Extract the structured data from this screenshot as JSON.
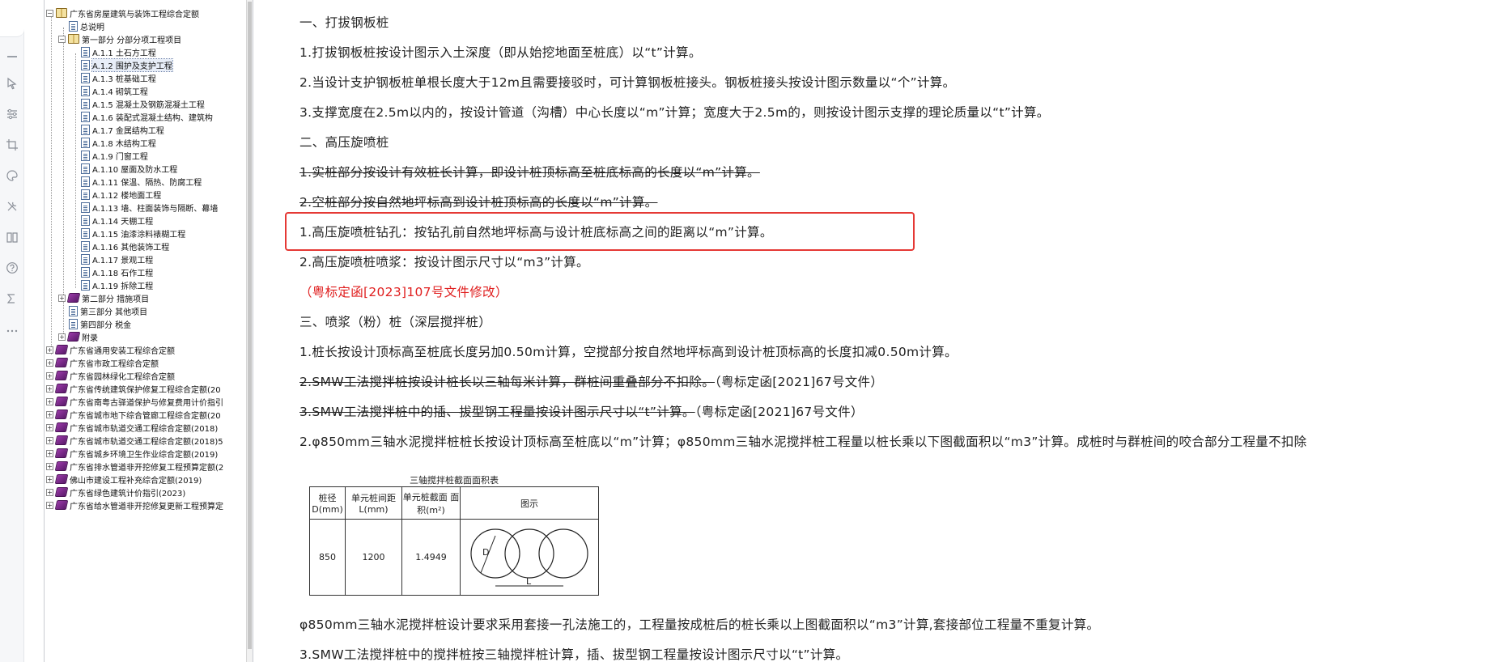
{
  "tree": {
    "root": "广东省房屋建筑与装饰工程综合定额",
    "general": "总说明",
    "part1": "第一部分 分部分项工程项目",
    "sections": [
      "A.1.1 土石方工程",
      "A.1.2 围护及支护工程",
      "A.1.3 桩基础工程",
      "A.1.4 砌筑工程",
      "A.1.5 混凝土及钢筋混凝土工程",
      "A.1.6 装配式混凝土结构、建筑构",
      "A.1.7 金属结构工程",
      "A.1.8 木结构工程",
      "A.1.9 门窗工程",
      "A.1.10 屋面及防水工程",
      "A.1.11 保温、隔热、防腐工程",
      "A.1.12 楼地面工程",
      "A.1.13 墙、柱面装饰与隔断、幕墙",
      "A.1.14 天棚工程",
      "A.1.15 油漆涂料裱糊工程",
      "A.1.16 其他装饰工程",
      "A.1.17 景观工程",
      "A.1.18 石作工程",
      "A.1.19 拆除工程"
    ],
    "part2": "第二部分 措施项目",
    "part3": "第三部分 其他项目",
    "part4": "第四部分 税金",
    "appendix": "附录",
    "others": [
      "广东省通用安装工程综合定额",
      "广东省市政工程综合定额",
      "广东省园林绿化工程综合定额",
      "广东省传统建筑保护修复工程综合定额(20",
      "广东省南粤古驿道保护与修复费用计价指引",
      "广东省城市地下综合管廊工程综合定额(20",
      "广东省城市轨道交通工程综合定额(2018)",
      "广东省城市轨道交通工程综合定额(2018)5",
      "广东省城乡环境卫生作业综合定额(2019)",
      "广东省排水管道非开挖修复工程预算定额(2",
      "佛山市建设工程补充综合定额(2019)",
      "广东省绿色建筑计价指引(2023)",
      "广东省给水管道非开挖修复更新工程预算定"
    ]
  },
  "content": {
    "h1": "一、打拔钢板桩",
    "s1_1": "1.打拔钢板桩按设计图示入土深度（即从始挖地面至桩底）以“t”计算。",
    "s1_2": "2.当设计支护钢板桩单根长度大于12m且需要接驳时，可计算钢板桩接头。钢板桩接头按设计图示数量以“个”计算。",
    "s1_3": "3.支撑宽度在2.5m以内的，按设计管道（沟槽）中心长度以“m”计算；宽度大于2.5m的，则按设计图示支撑的理论质量以“t”计算。",
    "h2": "二、高压旋喷桩",
    "s2_del1": "1.实桩部分按设计有效桩长计算，即设计桩顶标高至桩底标高的长度以“m”计算。",
    "s2_del2": "2.空桩部分按自然地坪标高到设计桩顶标高的长度以“m”计算。",
    "s2_1": "1.高压旋喷桩钻孔：按钻孔前自然地坪标高与设计桩底标高之间的距离以“m”计算。",
    "s2_2": "2.高压旋喷桩喷浆：按设计图示尺寸以“m3”计算。",
    "s2_note": "（粤标定函[2023]107号文件修改）",
    "h3": "三、喷浆（粉）桩（深层搅拌桩）",
    "s3_1": "1.桩长按设计顶标高至桩底长度另加0.50m计算，空搅部分按自然地坪标高到设计桩顶标高的长度扣减0.50m计算。",
    "s3_del2": "2.SMW工法搅拌桩按设计桩长以三轴每米计算，群桩间重叠部分不扣除。",
    "s3_del2_ref": "（粤标定函[2021]67号文件）",
    "s3_del3": "3.SMW工法搅拌桩中的插、拔型钢工程量按设计图示尺寸以“t”计算。",
    "s3_del3_ref": "（粤标定函[2021]67号文件）",
    "s3_2": "2.φ850mm三轴水泥搅拌桩桩长按设计顶标高至桩底以“m”计算；φ850mm三轴水泥搅拌桩工程量以桩长乘以下图截面积以“m3”计算。成桩时与群桩间的咬合部分工程量不扣除",
    "s3_after": "φ850mm三轴水泥搅拌桩设计要求采用套接一孔法施工的，工程量按成桩后的桩长乘以上图截面积以“m3”计算,套接部位工程量不重复计算。",
    "s3_3": "3.SMW工法搅拌桩中的搅拌桩按三轴搅拌桩计算，插、拔型钢工程量按设计图示尺寸以“t”计算。"
  },
  "figure": {
    "title": "三轴搅拌桩截面面积表",
    "headers": [
      "桩径 D(mm)",
      "单元桩间距 L(mm)",
      "单元桩截面 面积(m²)",
      "图示"
    ],
    "row": [
      "850",
      "1200",
      "1.4949"
    ],
    "diagram_labels": {
      "d": "D",
      "l": "L"
    }
  }
}
